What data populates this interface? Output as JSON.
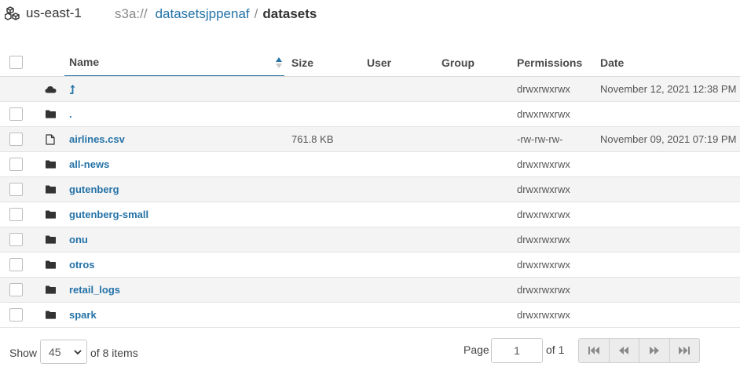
{
  "header": {
    "region": "us-east-1",
    "scheme": "s3a://",
    "bucket": "datasetsjppenaf",
    "separator": "/",
    "current_folder": "datasets"
  },
  "table": {
    "columns": {
      "name": "Name",
      "size": "Size",
      "user": "User",
      "group": "Group",
      "permissions": "Permissions",
      "date": "Date"
    },
    "sort": {
      "column": "name",
      "direction": "ascending"
    },
    "rows": [
      {
        "icon": "cloud-icon",
        "name": "",
        "size": "",
        "user": "",
        "group": "",
        "permissions": "drwxrwxrwx",
        "date": "November 12, 2021 12:38 PM",
        "kind": "parent"
      },
      {
        "icon": "folder-icon",
        "name": ".",
        "size": "",
        "user": "",
        "group": "",
        "permissions": "drwxrwxrwx",
        "date": "",
        "kind": "current"
      },
      {
        "icon": "file-icon",
        "name": "airlines.csv",
        "size": "761.8 KB",
        "user": "",
        "group": "",
        "permissions": "-rw-rw-rw-",
        "date": "November 09, 2021 07:19 PM",
        "kind": "file"
      },
      {
        "icon": "folder-icon",
        "name": "all-news",
        "size": "",
        "user": "",
        "group": "",
        "permissions": "drwxrwxrwx",
        "date": "",
        "kind": "dir"
      },
      {
        "icon": "folder-icon",
        "name": "gutenberg",
        "size": "",
        "user": "",
        "group": "",
        "permissions": "drwxrwxrwx",
        "date": "",
        "kind": "dir"
      },
      {
        "icon": "folder-icon",
        "name": "gutenberg-small",
        "size": "",
        "user": "",
        "group": "",
        "permissions": "drwxrwxrwx",
        "date": "",
        "kind": "dir"
      },
      {
        "icon": "folder-icon",
        "name": "onu",
        "size": "",
        "user": "",
        "group": "",
        "permissions": "drwxrwxrwx",
        "date": "",
        "kind": "dir"
      },
      {
        "icon": "folder-icon",
        "name": "otros",
        "size": "",
        "user": "",
        "group": "",
        "permissions": "drwxrwxrwx",
        "date": "",
        "kind": "dir"
      },
      {
        "icon": "folder-icon",
        "name": "retail_logs",
        "size": "",
        "user": "",
        "group": "",
        "permissions": "drwxrwxrwx",
        "date": "",
        "kind": "dir"
      },
      {
        "icon": "folder-icon",
        "name": "spark",
        "size": "",
        "user": "",
        "group": "",
        "permissions": "drwxrwxrwx",
        "date": "",
        "kind": "dir"
      }
    ]
  },
  "footer": {
    "show_label": "Show",
    "page_size": "45",
    "items_label": "of 8 items",
    "page_label": "Page",
    "page_value": "1",
    "of_pages": "of 1"
  },
  "colors": {
    "link": "#2573a7",
    "row_alt": "#f4f4f4",
    "border": "#e3e3e3"
  }
}
